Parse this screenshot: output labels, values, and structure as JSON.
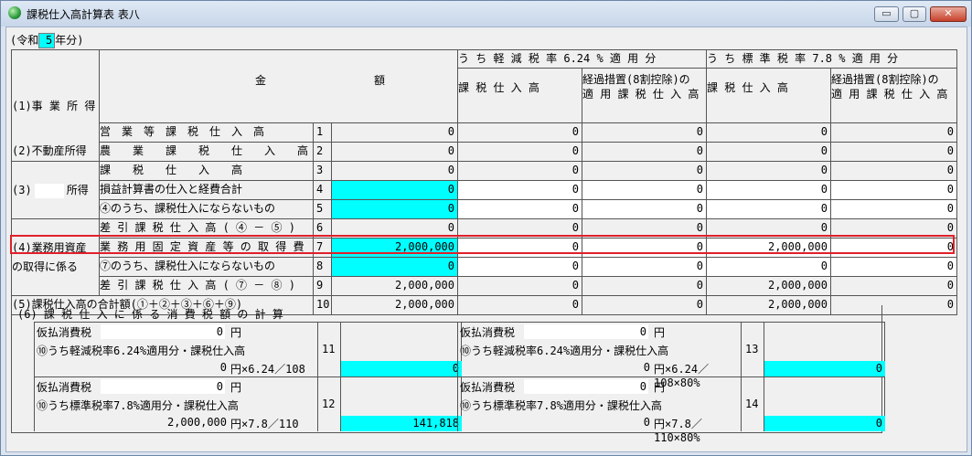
{
  "window": {
    "title": "課税仕入高計算表 表八",
    "minimize": "▭",
    "restore": "▢",
    "close": "✕"
  },
  "header": {
    "era_prefix": "(令和",
    "year": "5",
    "era_suffix": "年分)"
  },
  "col": {
    "kin": "金",
    "gaku": "額",
    "reduced_group": "う ち 軽 減 税 率 6.24 % 適 用 分",
    "standard_group": "う ち 標 準 税 率 7.8 % 適 用 分",
    "kazei1": "課 税 仕 入 高",
    "keika1a": "経過措置(8割控除)の",
    "keika1b": "適 用 課 税 仕 入 高",
    "kazei2": "課 税 仕 入 高",
    "keika2a": "経過措置(8割控除)の",
    "keika2b": "適 用 課 税 仕 入 高"
  },
  "sections": {
    "s1": "(1)事 業 所 得",
    "s2": "(2)不動産所得",
    "s3a": "(3)",
    "s3b": "所得",
    "s4a": "(4)業務用資産",
    "s4b": "の取得に係る",
    "s5": "(5)課税仕入高の合計額(①＋②＋③＋⑥＋⑨)"
  },
  "rows": [
    {
      "label": "営　業　等　課　税　仕　入　高",
      "no": "1",
      "amt": "0",
      "r1": "0",
      "r2": "0",
      "s1": "0",
      "s2": "0"
    },
    {
      "label": "農　　業　　課　　税　　仕　　入　　高",
      "no": "2",
      "amt": "0",
      "r1": "0",
      "r2": "0",
      "s1": "0",
      "s2": "0"
    },
    {
      "label": "課　　税　　仕　　入　　高",
      "no": "3",
      "amt": "0",
      "r1": "0",
      "r2": "0",
      "s1": "0",
      "s2": "0"
    },
    {
      "label": "損益計算書の仕入と経費合計",
      "no": "4",
      "amt": "0",
      "r1": "0",
      "r2": "0",
      "s1": "0",
      "s2": "0"
    },
    {
      "label": "④のうち、課税仕入にならないもの",
      "no": "5",
      "amt": "0",
      "r1": "0",
      "r2": "0",
      "s1": "0",
      "s2": "0"
    },
    {
      "label": "差 引 課 税 仕 入 高 ( ④ － ⑤ )",
      "no": "6",
      "amt": "0",
      "r1": "0",
      "r2": "0",
      "s1": "0",
      "s2": "0"
    },
    {
      "label": "業 務 用 固 定 資 産 等 の 取 得 費",
      "no": "7",
      "amt": "2,000,000",
      "r1": "0",
      "r2": "0",
      "s1": "2,000,000",
      "s2": "0"
    },
    {
      "label": "⑦のうち、課税仕入にならないもの",
      "no": "8",
      "amt": "0",
      "r1": "0",
      "r2": "0",
      "s1": "0",
      "s2": "0"
    },
    {
      "label": "差 引 課 税 仕 入 高 ( ⑦ － ⑧ )",
      "no": "9",
      "amt": "2,000,000",
      "r1": "0",
      "r2": "0",
      "s1": "2,000,000",
      "s2": "0"
    },
    {
      "label": "",
      "no": "10",
      "amt": "2,000,000",
      "r1": "0",
      "r2": "0",
      "s1": "2,000,000",
      "s2": "0"
    }
  ],
  "calc": {
    "title": "(6) 課 税 仕 入 に 係 る 消 費 税 額 の 計 算",
    "karibarai": "仮払消費税",
    "yen": "円",
    "b11": {
      "v": "0",
      "label": "⑩うち軽減税率6.24%適用分・課税仕入高",
      "base": "0",
      "formula": "円×6.24／108",
      "no": "11",
      "result": "0"
    },
    "b13": {
      "v": "0",
      "label": "⑩うち軽減税率6.24%適用分・課税仕入高",
      "base": "0",
      "formula": "円×6.24／108×80%",
      "no": "13",
      "result": "0"
    },
    "b12": {
      "v": "0",
      "label": "⑩うち標準税率7.8%適用分・課税仕入高",
      "base": "2,000,000",
      "formula": "円×7.8／110",
      "no": "12",
      "result": "141,818"
    },
    "b14": {
      "v": "0",
      "label": "⑩うち標準税率7.8%適用分・課税仕入高",
      "base": "0",
      "formula": "円×7.8／110×80%",
      "no": "14",
      "result": "0"
    }
  }
}
